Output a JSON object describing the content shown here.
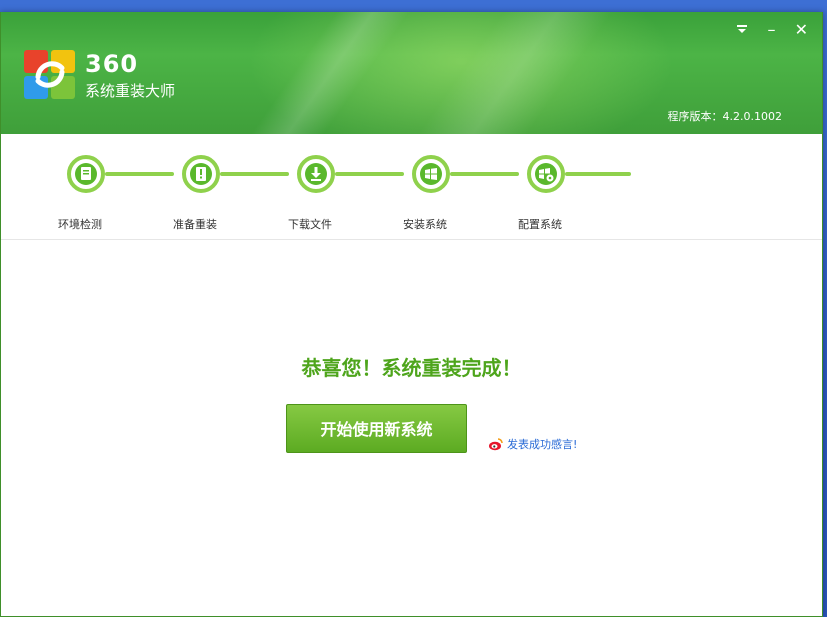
{
  "app": {
    "brand_number": "360",
    "brand_name": "系统重装大师",
    "version_text": "程序版本：4.2.0.1002"
  },
  "window_controls": {
    "menu_icon": "dropdown-menu-icon",
    "minimize_label": "–",
    "close_label": "✕"
  },
  "steps": [
    {
      "label": "环境检测",
      "icon": "document-icon"
    },
    {
      "label": "准备重装",
      "icon": "exclamation-book-icon"
    },
    {
      "label": "下载文件",
      "icon": "download-icon"
    },
    {
      "label": "安装系统",
      "icon": "windows-install-icon"
    },
    {
      "label": "配置系统",
      "icon": "windows-config-icon"
    }
  ],
  "main": {
    "congrats_text": "恭喜您！系统重装完成！",
    "start_button_label": "开始使用新系统",
    "share_link_label": "发表成功感言!"
  },
  "colors": {
    "header_green": "#4cb446",
    "step_green": "#8fd14c",
    "accent_green": "#5cab22",
    "link_blue": "#2a6bd6"
  }
}
